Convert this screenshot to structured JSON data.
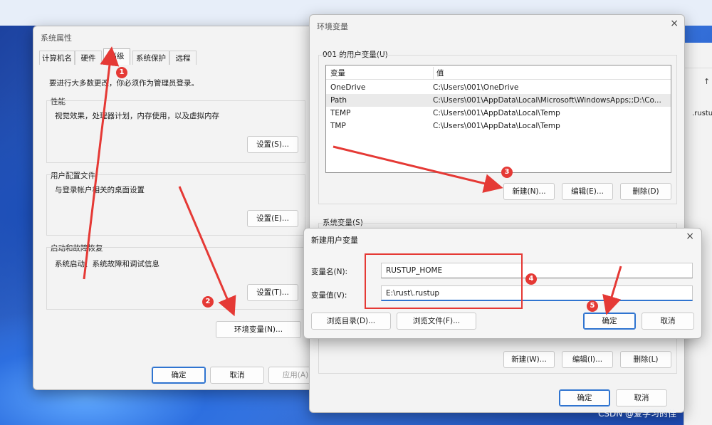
{
  "sysprops": {
    "title": "系统属性",
    "tabs": [
      "计算机名",
      "硬件",
      "高级",
      "系统保护",
      "远程"
    ],
    "admin_note": "要进行大多数更改，你必须作为管理员登录。",
    "perf": {
      "label": "性能",
      "desc": "视觉效果，处理器计划，内存使用，以及虚拟内存",
      "button": "设置(S)..."
    },
    "profile": {
      "label": "用户配置文件",
      "desc": "与登录帐户相关的桌面设置",
      "button": "设置(E)..."
    },
    "startup": {
      "label": "启动和故障恢复",
      "desc": "系统启动、系统故障和调试信息",
      "button": "设置(T)..."
    },
    "env_button": "环境变量(N)...",
    "ok": "确定",
    "cancel": "取消",
    "apply": "应用(A)"
  },
  "envvars": {
    "title": "环境变量",
    "close": "×",
    "user_group": "001 的用户变量(U)",
    "columns": [
      "变量",
      "值"
    ],
    "user_rows": [
      {
        "name": "OneDrive",
        "value": "C:\\Users\\001\\OneDrive"
      },
      {
        "name": "Path",
        "value": "C:\\Users\\001\\AppData\\Local\\Microsoft\\WindowsApps;;D:\\Co..."
      },
      {
        "name": "TEMP",
        "value": "C:\\Users\\001\\AppData\\Local\\Temp"
      },
      {
        "name": "TMP",
        "value": "C:\\Users\\001\\AppData\\Local\\Temp"
      }
    ],
    "user_new": "新建(N)...",
    "user_edit": "编辑(E)...",
    "user_delete": "删除(D)",
    "sys_group": "系统变量(S)",
    "sys_new": "新建(W)...",
    "sys_edit": "编辑(I)...",
    "sys_delete": "删除(L)",
    "ok": "确定",
    "cancel": "取消"
  },
  "newvar": {
    "title": "新建用户变量",
    "close": "×",
    "name_label": "变量名(N):",
    "name_value": "RUSTUP_HOME",
    "value_label": "变量值(V):",
    "value_value": "E:\\rust\\.rustup",
    "browse_dir": "浏览目录(D)...",
    "browse_file": "浏览文件(F)...",
    "ok": "确定",
    "cancel": "取消"
  },
  "background": {
    "right_text": ".rustu",
    "right_arrow": "↑"
  },
  "annotations": {
    "badges": [
      "1",
      "2",
      "3",
      "4",
      "5"
    ],
    "color": "#e53935"
  },
  "watermark": "CSDN @爱学习的佳"
}
